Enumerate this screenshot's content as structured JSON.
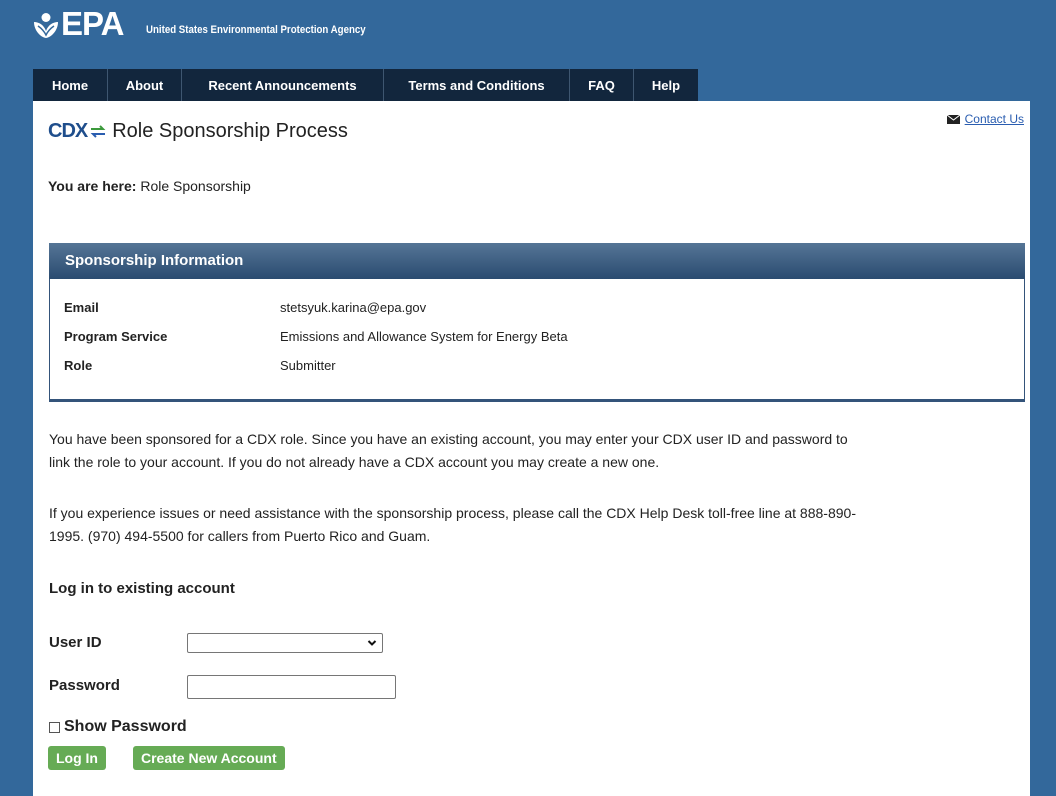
{
  "header": {
    "logo_text": "EPA",
    "agency": "United States Environmental Protection Agency"
  },
  "nav": {
    "items": [
      "Home",
      "About",
      "Recent Announcements",
      "Terms and Conditions",
      "FAQ",
      "Help"
    ]
  },
  "title_bar": {
    "cdx_logo": "CDX",
    "title": "Role Sponsorship Process",
    "contact": "Contact Us"
  },
  "breadcrumb": {
    "label": "You are here:",
    "current": "Role Sponsorship"
  },
  "sponsorship": {
    "heading": "Sponsorship Information",
    "rows": [
      {
        "label": "Email",
        "value": "stetsyuk.karina@epa.gov"
      },
      {
        "label": "Program Service",
        "value": "Emissions and Allowance System for Energy Beta"
      },
      {
        "label": "Role",
        "value": "Submitter"
      }
    ]
  },
  "body": {
    "para1_line1": "You have been sponsored for a CDX role. Since you have an existing account, you may enter your CDX user ID and password to",
    "para1_line2": "link the role to your account. If you do not already have a CDX account you may create a new one.",
    "para2_line1": "If you experience issues or need assistance with the sponsorship process, please call the CDX Help Desk toll-free line at 888-890-",
    "para2_line2": "1995. (970) 494-5500 for callers from Puerto Rico and Guam."
  },
  "login": {
    "heading": "Log in to existing account",
    "user_id_label": "User ID",
    "user_id_value": "",
    "password_label": "Password",
    "password_value": "",
    "show_password": "Show Password",
    "login_button": "Log In",
    "create_button": "Create New Account"
  },
  "colors": {
    "page_bg": "#33689b",
    "nav_bg": "#12263d",
    "panel_header": "#2a4b70",
    "button_green": "#66ab55",
    "link": "#2a5db0"
  },
  "icons": {
    "logo": "epa-flower-icon",
    "contact": "envelope-icon",
    "select": "chevron-down-icon",
    "cdx": "cdx-arrows-icon"
  }
}
